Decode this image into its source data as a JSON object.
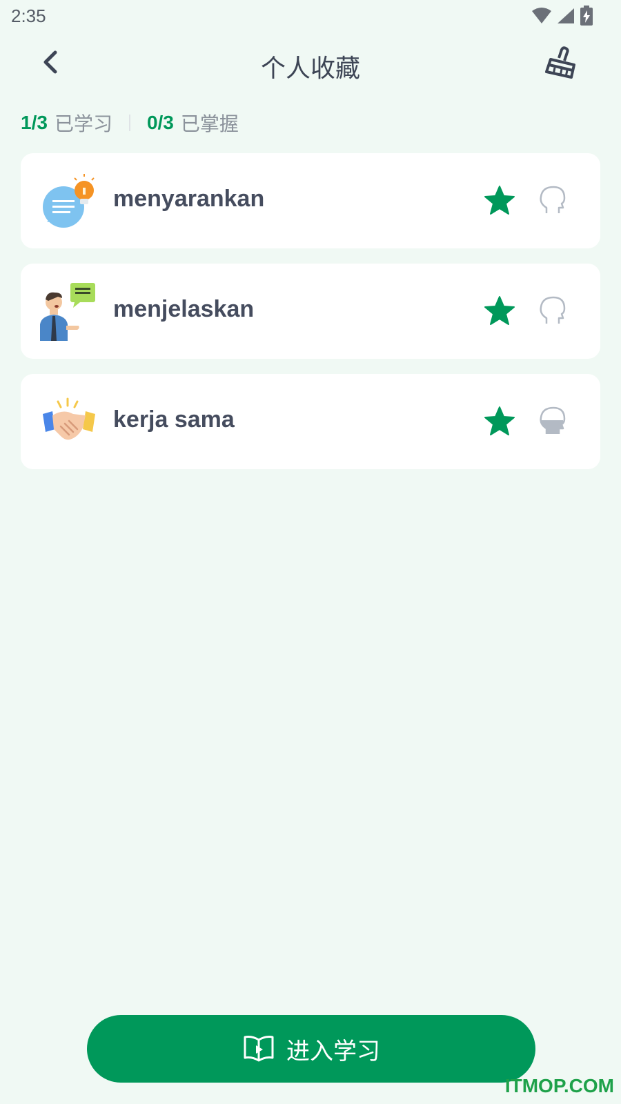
{
  "status": {
    "time": "2:35"
  },
  "header": {
    "title": "个人收藏"
  },
  "stats": {
    "learned_count": "1/3",
    "learned_label": "已学习",
    "mastered_count": "0/3",
    "mastered_label": "已掌握"
  },
  "words": [
    {
      "word": "menyarankan",
      "icon": "speech-bubble-lightbulb-icon"
    },
    {
      "word": "menjelaskan",
      "icon": "person-explaining-icon"
    },
    {
      "word": "kerja sama",
      "icon": "handshake-icon"
    }
  ],
  "cta": {
    "label": "进入学习"
  },
  "watermark": "ITMOP.COM",
  "colors": {
    "accent": "#00985a",
    "background": "#f0f9f4",
    "card": "#ffffff"
  }
}
